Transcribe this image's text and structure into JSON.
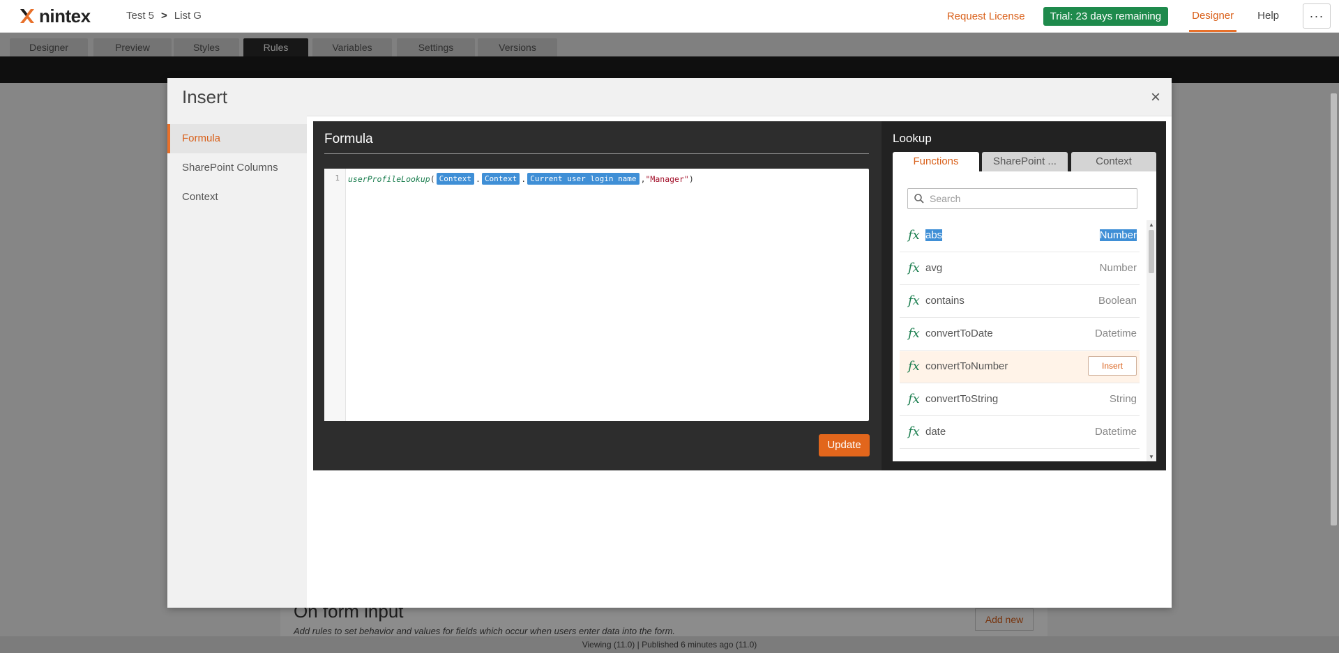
{
  "app": {
    "logo_text": "nintex",
    "breadcrumb": [
      "Test 5",
      "List G"
    ],
    "breadcrumb_sep": ">",
    "request_license": "Request License",
    "trial_badge": "Trial: 23 days remaining",
    "nav": [
      {
        "label": "Designer",
        "active": true
      },
      {
        "label": "Help",
        "active": false
      }
    ],
    "more_label": "···"
  },
  "tabs": [
    {
      "label": "Designer"
    },
    {
      "label": "Preview"
    },
    {
      "label": "Styles"
    },
    {
      "label": "Rules",
      "active": true
    },
    {
      "label": "Variables"
    },
    {
      "label": "Settings"
    },
    {
      "label": "Versions"
    }
  ],
  "background": {
    "section_title": "On form input",
    "section_subtitle": "Add rules to set behavior and values for fields which occur when users enter data into the form.",
    "add_new": "Add new",
    "status": "Viewing (11.0)  |  Published 6 minutes ago (11.0)"
  },
  "modal": {
    "title": "Insert",
    "close": "×",
    "sidebar": [
      {
        "label": "Formula",
        "active": true
      },
      {
        "label": "SharePoint Columns"
      },
      {
        "label": "Context"
      }
    ],
    "formula": {
      "title": "Formula",
      "line_number": "1",
      "function_name": "userProfileLookup",
      "open_paren": "(",
      "tokens": [
        "Context",
        "Context",
        "Current user login name"
      ],
      "dot": ".",
      "comma": ",",
      "string_arg": "\"Manager\"",
      "close_paren": ")",
      "update_label": "Update"
    },
    "lookup": {
      "title": "Lookup",
      "tabs": [
        {
          "label": "Functions",
          "active": true
        },
        {
          "label": "SharePoint ..."
        },
        {
          "label": "Context"
        }
      ],
      "search_placeholder": "Search",
      "fx_symbol": "fx",
      "insert_label": "Insert",
      "functions": [
        {
          "name": "abs",
          "type": "Number",
          "selected": true
        },
        {
          "name": "avg",
          "type": "Number"
        },
        {
          "name": "contains",
          "type": "Boolean"
        },
        {
          "name": "convertToDate",
          "type": "Datetime"
        },
        {
          "name": "convertToNumber",
          "type": "",
          "hover": true
        },
        {
          "name": "convertToString",
          "type": "String"
        },
        {
          "name": "date",
          "type": "Datetime"
        }
      ]
    }
  },
  "colors": {
    "accent": "#e8702a",
    "trial_green": "#1e8a4c",
    "token_blue": "#3f8fd6",
    "fx_green": "#1b7e4f"
  }
}
